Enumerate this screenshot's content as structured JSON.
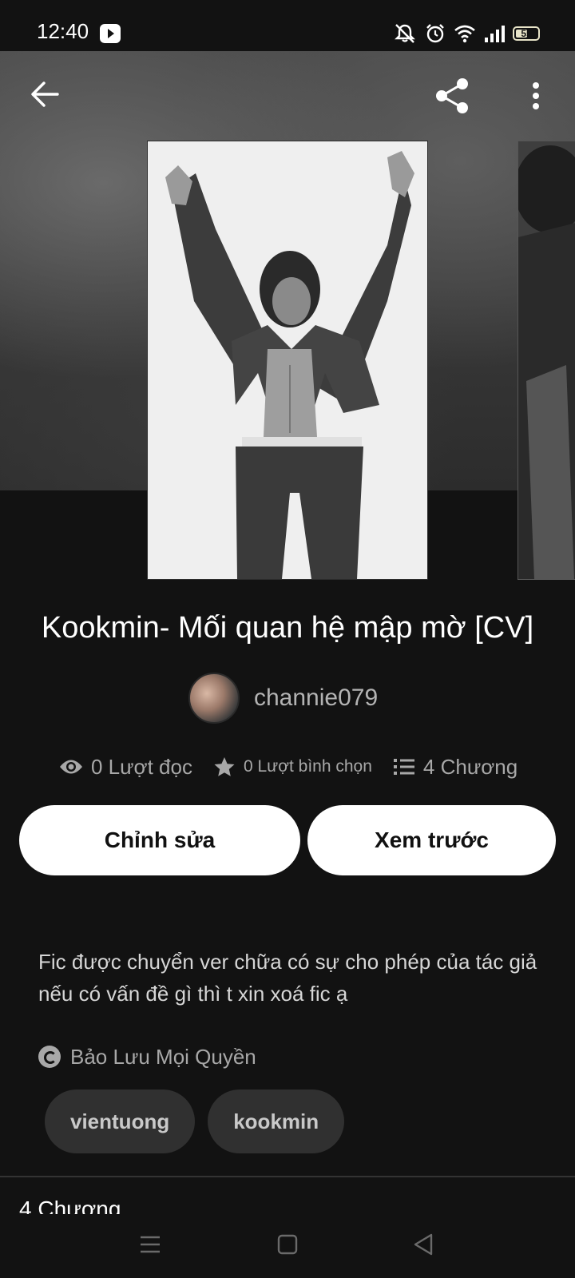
{
  "status_bar": {
    "time": "12:40",
    "battery_level": "55",
    "battery_fraction": 0.55,
    "icons": [
      "youtube-icon",
      "mute-bell-icon",
      "alarm-icon",
      "wifi-icon",
      "signal-icon",
      "battery-icon"
    ]
  },
  "header": {
    "icons": [
      "back-arrow-icon",
      "share-icon",
      "more-vertical-icon"
    ]
  },
  "story": {
    "title": "Kookmin- Mối quan hệ mập mờ [CV]",
    "author": "channie079",
    "stats": {
      "reads": "0 Lượt đọc",
      "votes": "0 Lượt bình chọn",
      "chapters": "4 Chương"
    },
    "description": "Fic được chuyển ver chữa có sự cho phép của tác giả nếu có vấn đề gì thì t xin xoá fic ạ",
    "copyright": "Bảo Lưu Mọi Quyền",
    "tags": [
      "vientuong",
      "kookmin"
    ]
  },
  "actions": {
    "edit_label": "Chỉnh sửa",
    "preview_label": "Xem trước"
  },
  "chapters_section": {
    "heading": "4 Chương"
  },
  "nav_bar": {
    "icons": [
      "menu-icon",
      "home-square-icon",
      "back-triangle-icon"
    ]
  },
  "colors": {
    "background": "#121212",
    "button": "#ffffff",
    "tag_background": "#303030",
    "muted_text": "#a8a8a8"
  }
}
